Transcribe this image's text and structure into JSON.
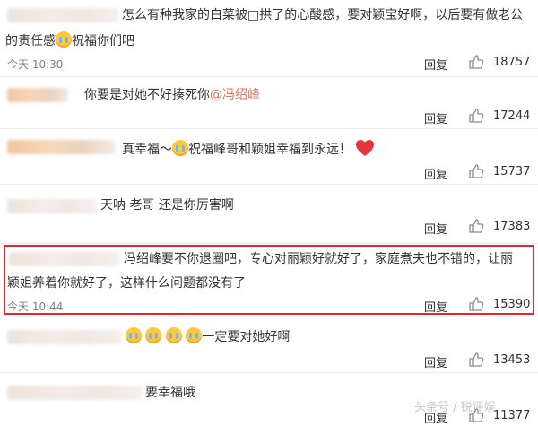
{
  "comments": [
    {
      "line1": "怎么有种我家的白菜被□拱了的心酸感，要对颖宝好啊，以后要有做老公",
      "line2": "的责任感",
      "line2b": "祝福你们吧",
      "time": "今天 10:30",
      "reply": "回复",
      "likes": "18757"
    },
    {
      "text": "你要是对她不好揍死你",
      "mention": "@冯绍峰",
      "reply": "回复",
      "likes": "17244"
    },
    {
      "text_a": "真幸福～",
      "text_b": "祝福峰哥和颖姐幸福到永远！",
      "reply": "回复",
      "likes": "15737"
    },
    {
      "text": "天呐  老哥  还是你厉害啊",
      "reply": "回复",
      "likes": "17383"
    },
    {
      "line1": "冯绍峰要不你退圈吧，专心对丽颖好就好了，家庭煮夫也不错的，让丽",
      "line2": "颖姐养着你就好了，这样什么问题都没有了",
      "time": "今天 10:44",
      "reply": "回复",
      "likes": "15390"
    },
    {
      "text": "一定要对她好啊",
      "reply": "回复",
      "likes": "13453"
    },
    {
      "text": "要幸福哦",
      "reply": "回复",
      "likes": "11377"
    }
  ],
  "watermark": "头条号 / 锐评娱",
  "colors": {
    "mention": "#eb7350",
    "highlight_border": "#e0282f",
    "heart": "#e8343c"
  },
  "icons": {
    "like": "thumbs-up-icon",
    "crying": "crying-face-icon",
    "heart": "heart-icon"
  }
}
